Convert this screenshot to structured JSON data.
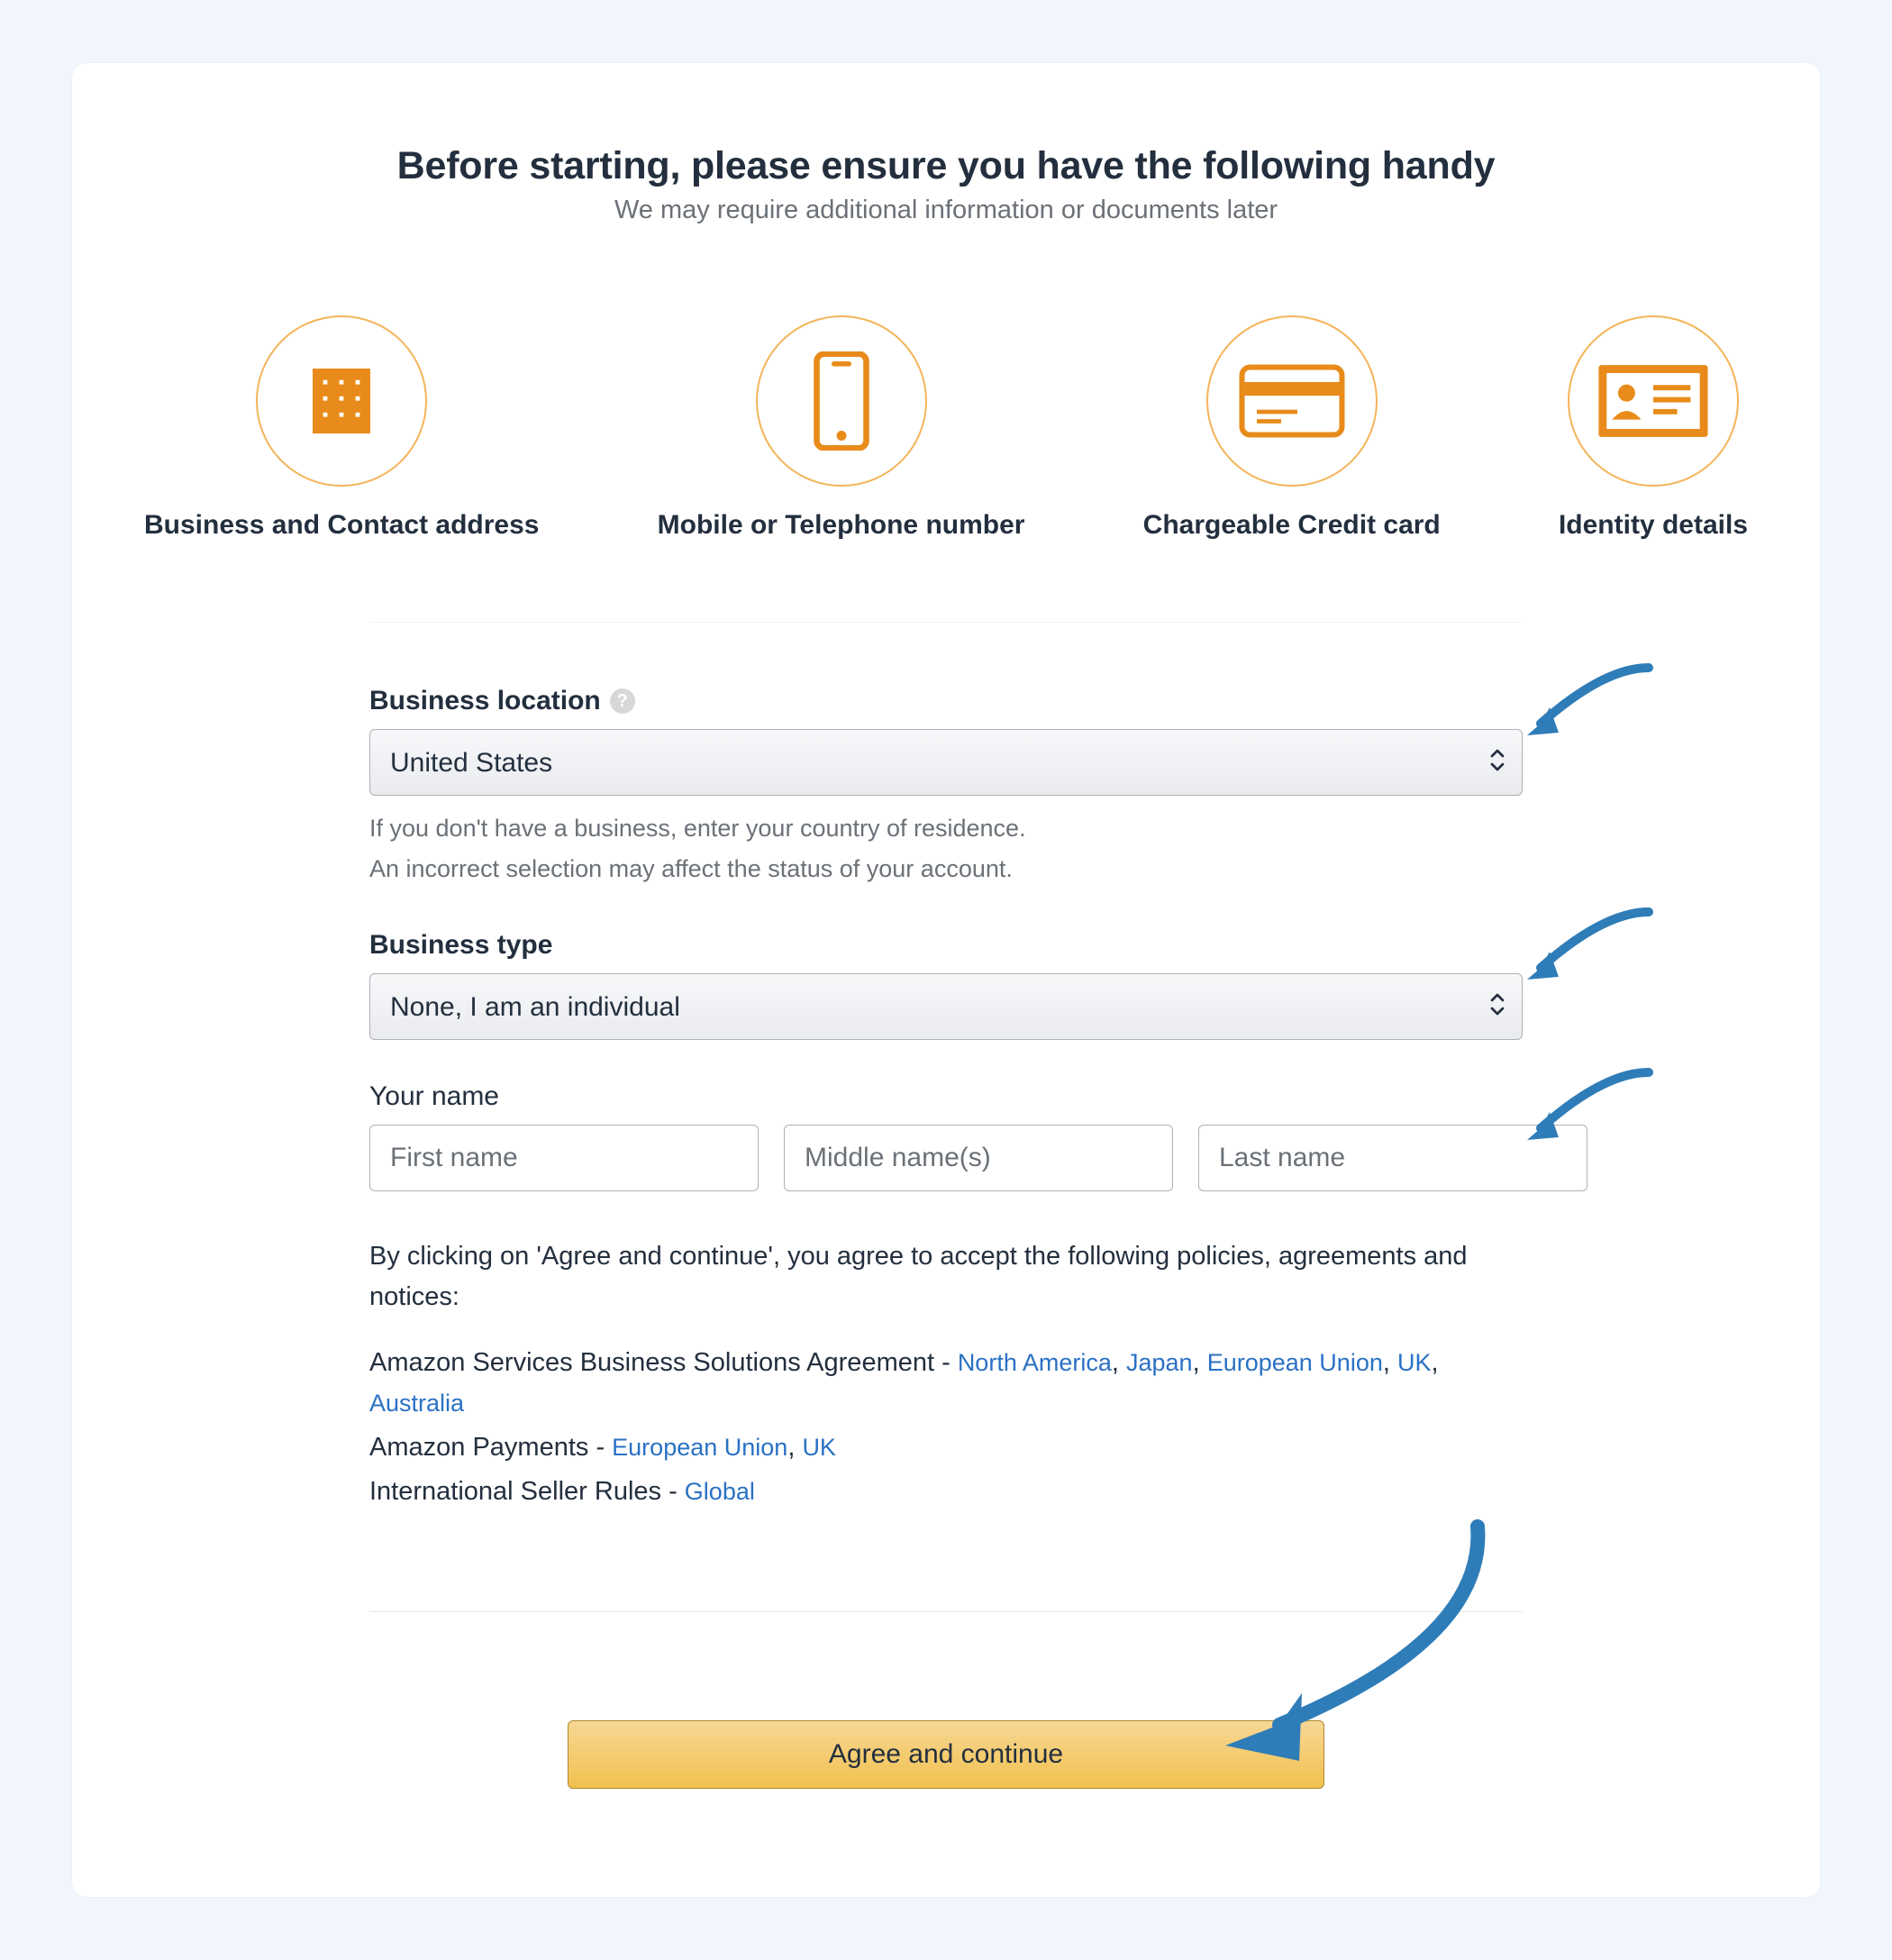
{
  "heading": {
    "title": "Before starting, please ensure you have the following handy",
    "subtitle": "We may require additional information or documents later"
  },
  "requirements": {
    "business_contact": "Business and Contact address",
    "mobile": "Mobile or Telephone number",
    "credit": "Chargeable Credit card",
    "identity": "Identity details"
  },
  "form": {
    "business_location": {
      "label": "Business location",
      "selected": "United States",
      "hint1": "If you don't have a business, enter your country of residence.",
      "hint2": "An incorrect selection may affect the status of your account."
    },
    "business_type": {
      "label": "Business type",
      "selected": "None, I am an individual"
    },
    "your_name": {
      "label": "Your name",
      "first_ph": "First name",
      "middle_ph": "Middle name(s)",
      "last_ph": "Last name"
    }
  },
  "legal": {
    "intro": "By clicking on 'Agree and continue', you agree to accept the following policies, agreements and notices:",
    "asbsa_label": "Amazon Services Business Solutions Agreement - ",
    "na": "North America",
    "japan": "Japan",
    "eu": "European Union",
    "uk": "UK",
    "australia": "Australia",
    "payments_label": "Amazon Payments - ",
    "isr_label": "International Seller Rules - ",
    "global": "Global",
    "comma": ", "
  },
  "cta": {
    "label": "Agree and continue"
  }
}
